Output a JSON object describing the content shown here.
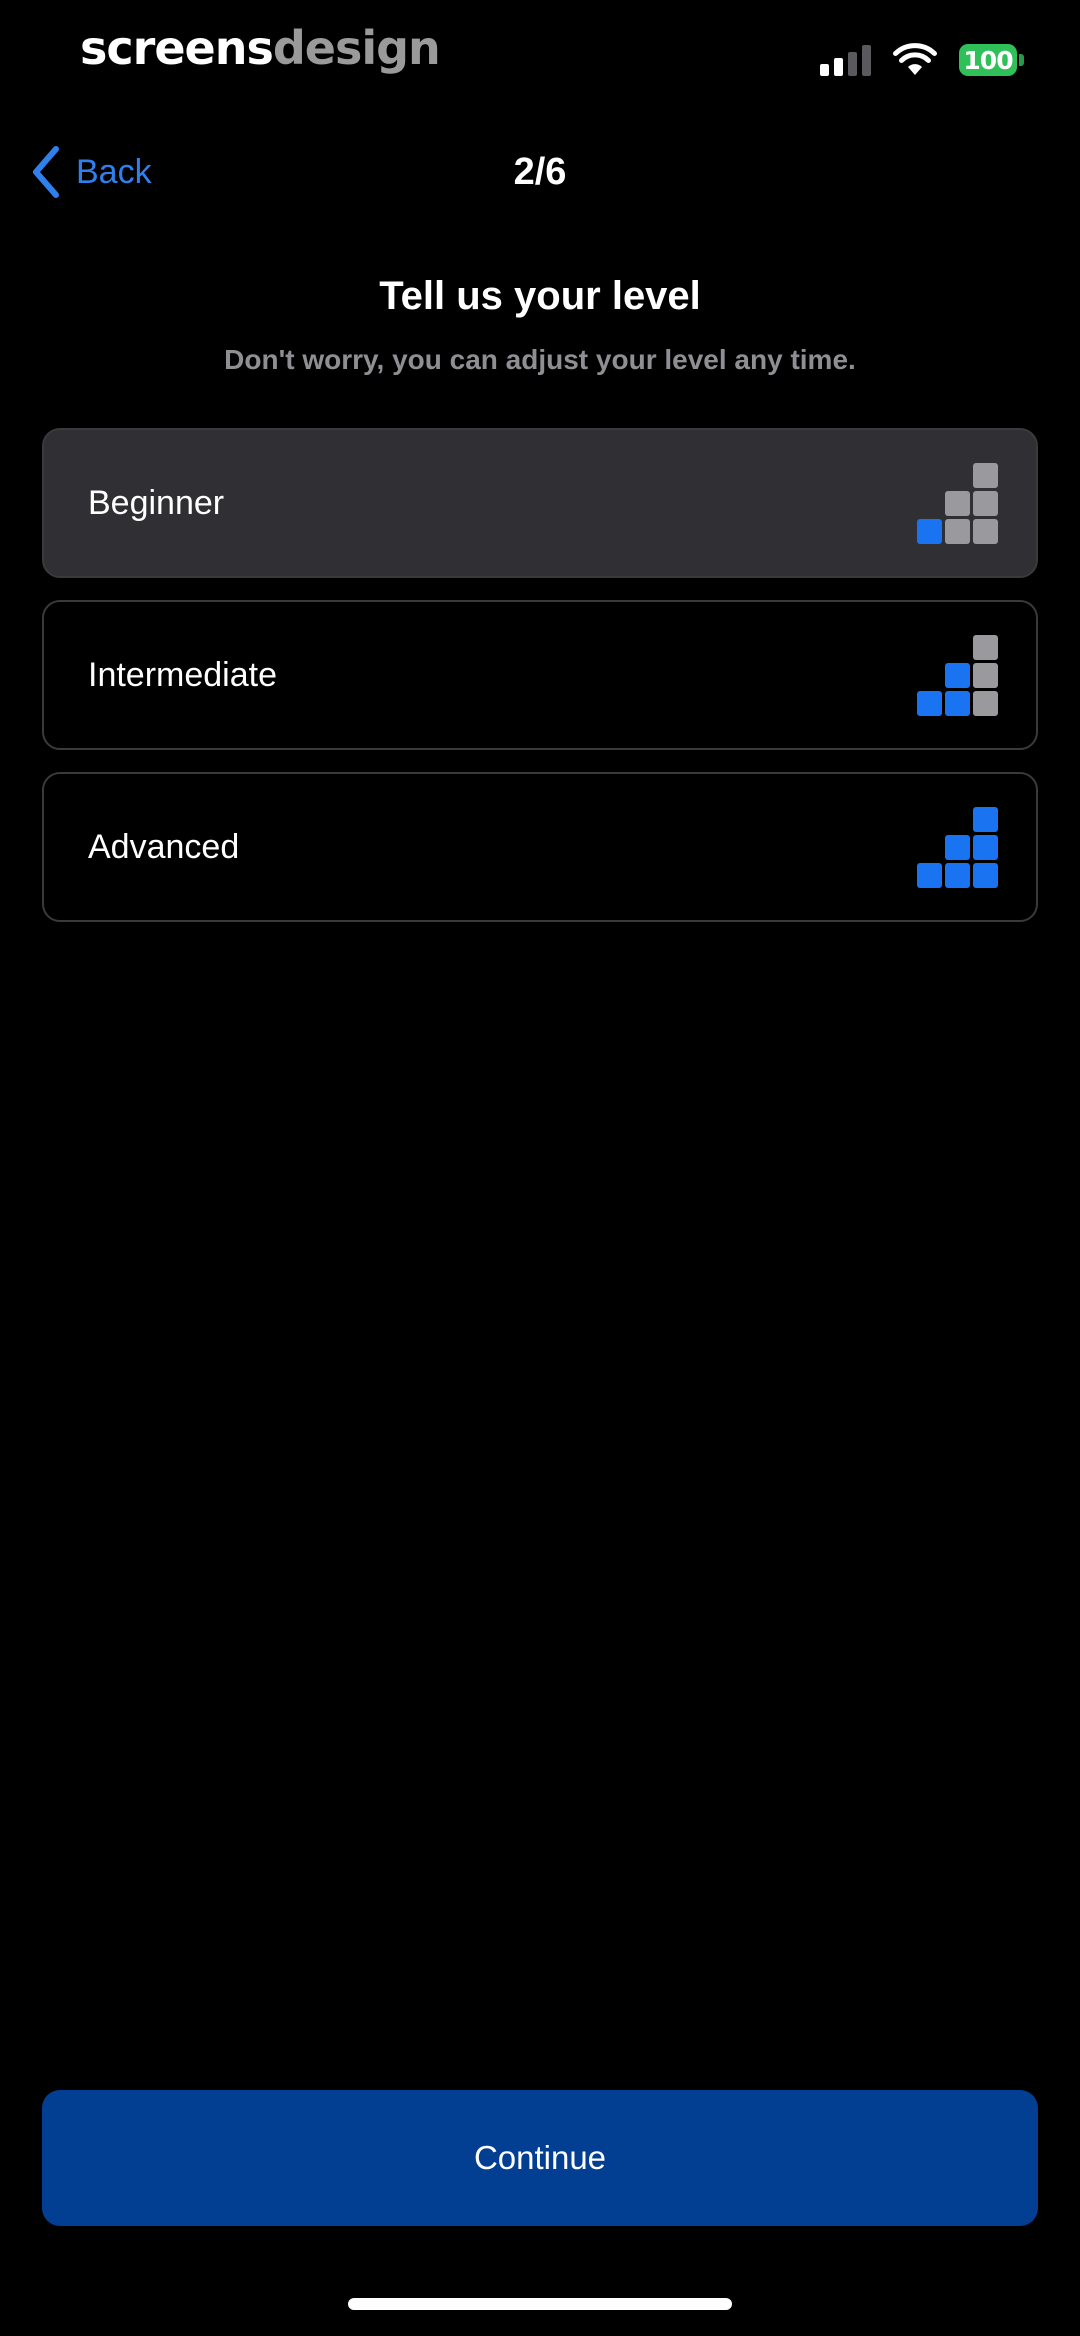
{
  "watermark": {
    "part1": "screens",
    "part2": "design"
  },
  "status_bar": {
    "battery": "100",
    "signal_bars": 2,
    "colors": {
      "battery": "#2fc05a",
      "signal_active": "#ffffff",
      "signal_inactive": "#5a5a5e"
    },
    "icons": {
      "signal": "cellular-signal-icon",
      "wifi": "wifi-icon",
      "battery": "battery-icon"
    }
  },
  "nav": {
    "back_label": "Back",
    "back_icon": "chevron-left-icon",
    "step": "2/6"
  },
  "header": {
    "title": "Tell us your level",
    "subtitle": "Don't worry, you can adjust your level any time."
  },
  "options": [
    {
      "label": "Beginner",
      "selected": true,
      "level": 1,
      "icon": "level-bars-icon"
    },
    {
      "label": "Intermediate",
      "selected": false,
      "level": 2,
      "icon": "level-bars-icon"
    },
    {
      "label": "Advanced",
      "selected": false,
      "level": 3,
      "icon": "level-bars-icon"
    }
  ],
  "colors": {
    "accent": "#2f80ed",
    "level_active": "#1a73f0",
    "level_inactive": "#9a9a9e",
    "selected_card": "#303034",
    "continue_button": "#023f93"
  },
  "continue": {
    "label": "Continue"
  }
}
